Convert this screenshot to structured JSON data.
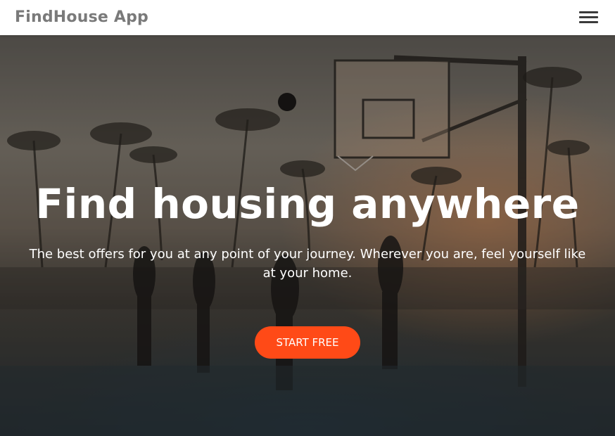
{
  "navbar": {
    "brand": "FindHouse App",
    "menu_icon": "hamburger-menu-icon"
  },
  "hero": {
    "background_image": "basketball-court-sunset-photo",
    "title": "Find housing anywhere",
    "subtitle": "The best offers for you at any point of your journey. Wherever you are, feel yourself like at your home.",
    "cta_label": "START FREE"
  },
  "colors": {
    "navbar_bg": "#ffffff",
    "brand_text": "#7a7a7a",
    "cta_bg": "#ff4a17",
    "cta_text": "#ffffff",
    "hero_text": "#ffffff"
  }
}
